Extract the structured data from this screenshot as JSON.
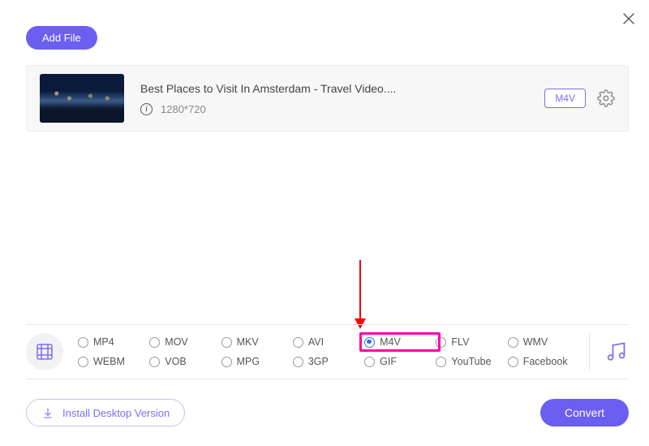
{
  "header": {
    "add_file_label": "Add File"
  },
  "file": {
    "title": "Best Places to Visit In Amsterdam - Travel Video....",
    "resolution": "1280*720",
    "format_badge": "M4V"
  },
  "formats": {
    "row1": [
      "MP4",
      "MOV",
      "MKV",
      "AVI",
      "M4V",
      "FLV",
      "WMV"
    ],
    "row2": [
      "WEBM",
      "VOB",
      "MPG",
      "3GP",
      "GIF",
      "YouTube",
      "Facebook"
    ],
    "selected": "M4V"
  },
  "footer": {
    "install_label": "Install Desktop Version",
    "convert_label": "Convert"
  },
  "annotation": {
    "highlight_format": "M4V"
  }
}
